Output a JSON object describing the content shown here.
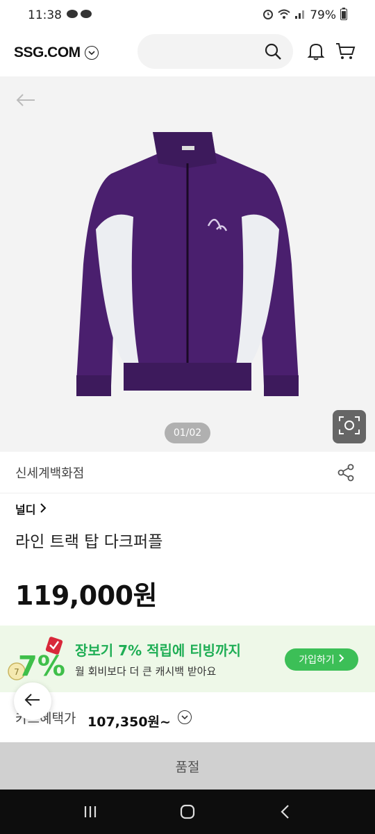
{
  "status": {
    "time": "11:38",
    "battery": "79%"
  },
  "header": {
    "logo": "SSG.COM",
    "search_placeholder": ""
  },
  "gallery": {
    "page_indicator": "01/02"
  },
  "store": {
    "name": "신세계백화점"
  },
  "product": {
    "brand": "널디",
    "title": "라인 트랙 탑 다크퍼플",
    "price": "119,000원"
  },
  "promo": {
    "title": "장보기 7% 적립에 티빙까지",
    "subtitle": "월 회비보다 더 큰 캐시백 받아요",
    "badge_text": "7%",
    "join_label": "가입하기"
  },
  "card_benefit": {
    "label": "카드혜택가",
    "price": "107,350원~"
  },
  "footer": {
    "soldout_label": "품절"
  },
  "colors": {
    "accent_green": "#1fae55",
    "product_purple": "#4a1f6e",
    "promo_bg": "#eef8e8"
  }
}
